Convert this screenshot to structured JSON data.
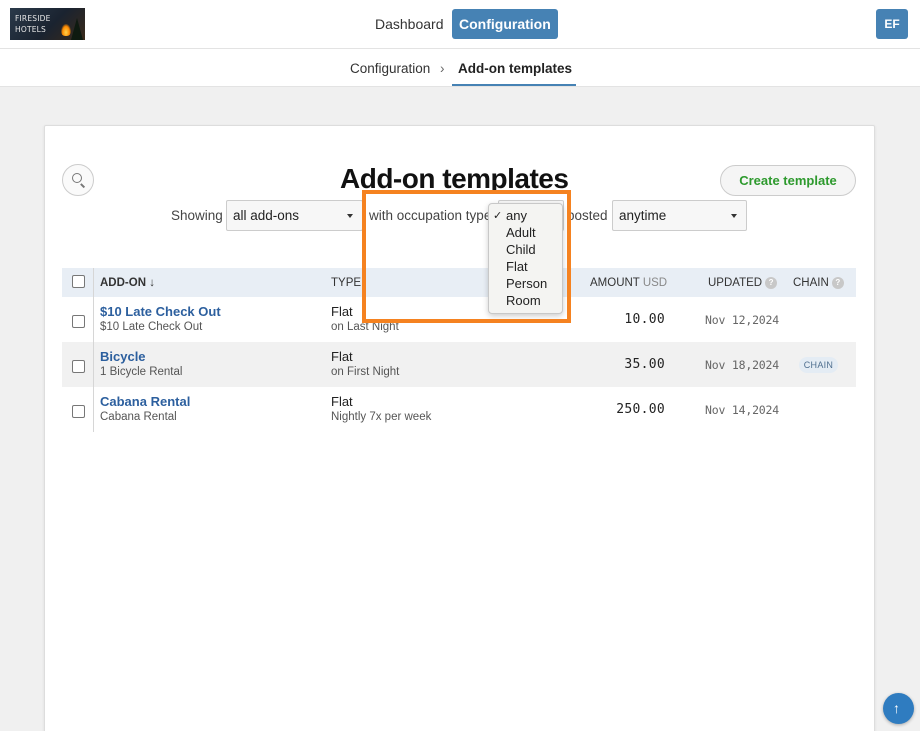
{
  "header": {
    "logo_text_line1": "FIRESIDE",
    "logo_text_line2": "HOTELS",
    "nav": [
      {
        "label": "Dashboard",
        "active": false
      },
      {
        "label": "Configuration",
        "active": true
      }
    ],
    "avatar_initials": "EF"
  },
  "breadcrumb": {
    "parent": "Configuration",
    "separator": "›",
    "current": "Add-on templates"
  },
  "page": {
    "title": "Add-on templates",
    "create_button": "Create template",
    "filters": {
      "showing_label": "Showing",
      "showing_value": "all add-ons",
      "occupation_label": "with occupation type",
      "posted_label": "posted",
      "posted_value": "anytime"
    },
    "occupation_dropdown": {
      "selected": "any",
      "options": [
        "any",
        "Adult",
        "Child",
        "Flat",
        "Person",
        "Room"
      ]
    }
  },
  "table": {
    "headers": {
      "addon": "ADD-ON ↓",
      "type": "TYPE",
      "amount": "AMOUNT",
      "currency": "USD",
      "updated": "UPDATED",
      "chain": "CHAIN",
      "help": "?"
    },
    "rows": [
      {
        "name": "$10 Late Check Out",
        "subtitle": "$10 Late Check Out",
        "type": "Flat",
        "type_detail": "on Last Night",
        "amount": "10.00",
        "updated": "Nov 12,2024",
        "chain": ""
      },
      {
        "name": "Bicycle",
        "subtitle": "1 Bicycle Rental",
        "type": "Flat",
        "type_detail": "on First Night",
        "amount": "35.00",
        "updated": "Nov 18,2024",
        "chain": "CHAIN"
      },
      {
        "name": "Cabana Rental",
        "subtitle": "Cabana Rental",
        "type": "Flat",
        "type_detail": "Nightly 7x per week",
        "amount": "250.00",
        "updated": "Nov 14,2024",
        "chain": ""
      }
    ]
  },
  "colors": {
    "accent": "#4682b4",
    "highlight": "#f58220",
    "create_green": "#2e9a2e",
    "link_blue": "#2c5f9e"
  },
  "scroll_top_icon": "arrow-up-icon"
}
